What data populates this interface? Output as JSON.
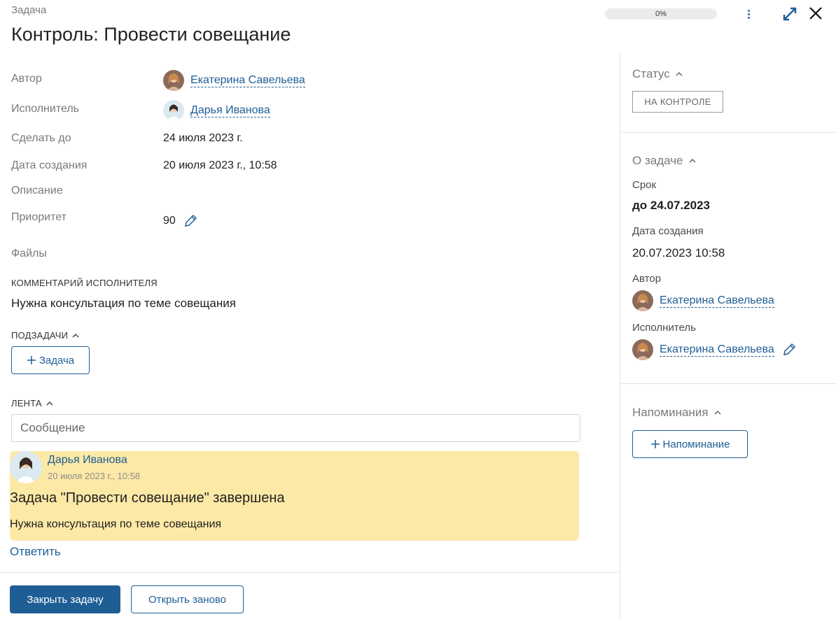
{
  "header": {
    "subtitle": "Задача",
    "title": "Контроль: Провести совещание",
    "progress": {
      "value": 0,
      "label": "0%"
    }
  },
  "fields": {
    "author": {
      "label": "Автор",
      "name": "Екатерина Савельева"
    },
    "assignee": {
      "label": "Исполнитель",
      "name": "Дарья Иванова"
    },
    "due": {
      "label": "Сделать до",
      "value": "24 июля 2023 г."
    },
    "created": {
      "label": "Дата создания",
      "value": "20 июля 2023 г., 10:58"
    },
    "description": {
      "label": "Описание"
    },
    "priority": {
      "label": "Приоритет",
      "value": "90"
    },
    "files": {
      "label": "Файлы"
    }
  },
  "comment": {
    "title": "КОММЕНТАРИЙ ИСПОЛНИТЕЛЯ",
    "text": "Нужна консультация по теме совещания"
  },
  "subtasks": {
    "title": "ПОДЗАДАЧИ",
    "add_label": "Задача"
  },
  "feed": {
    "title": "ЛЕНТА",
    "input_placeholder": "Сообщение",
    "entries": [
      {
        "author": "Дарья Иванова",
        "time": "20 июля 2023 г., 10:58",
        "title": "Задача \"Провести совещание\" завершена",
        "text": "Нужна консультация по теме совещания"
      }
    ],
    "reply_label": "Ответить"
  },
  "actions": {
    "close_task": "Закрыть задачу",
    "reopen": "Открыть заново"
  },
  "sidebar": {
    "status": {
      "title": "Статус",
      "value": "НА КОНТРОЛЕ"
    },
    "about": {
      "title": "О задаче",
      "deadline_label": "Срок",
      "deadline_value": "до 24.07.2023",
      "created_label": "Дата создания",
      "created_value": "20.07.2023 10:58",
      "author_label": "Автор",
      "author_name": "Екатерина Савельева",
      "assignee_label": "Исполнитель",
      "assignee_name": "Екатерина Савельева"
    },
    "reminders": {
      "title": "Напоминания",
      "add_label": "Напоминание"
    }
  },
  "colors": {
    "accent": "#1f5e95",
    "feed_card": "#fde9a6",
    "muted_text": "#7a7a7a"
  }
}
